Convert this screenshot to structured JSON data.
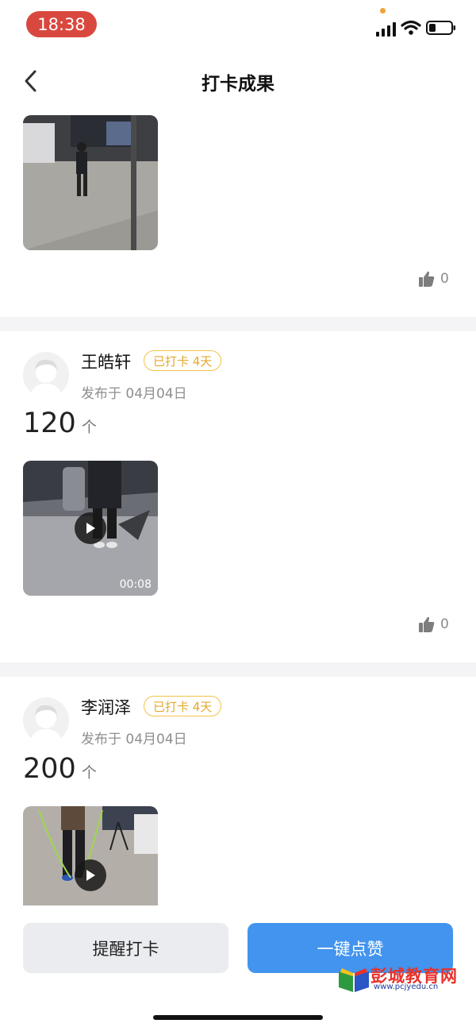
{
  "status_bar": {
    "time": "18:38"
  },
  "nav": {
    "title": "打卡成果"
  },
  "posts": [
    {
      "likes": "0"
    },
    {
      "user_name": "王皓轩",
      "badge": "已打卡 4天",
      "published": "发布于 04月04日",
      "count": "120",
      "unit": "个",
      "video_duration": "00:08",
      "likes": "0"
    },
    {
      "user_name": "李润泽",
      "badge": "已打卡 4天",
      "published": "发布于 04月04日",
      "count": "200",
      "unit": "个"
    }
  ],
  "bottom": {
    "remind_label": "提醒打卡",
    "like_all_label": "一键点赞"
  },
  "watermark": {
    "title": "彭城教育网",
    "url": "www.pcjyedu.cn"
  },
  "colors": {
    "accent": "#4294ee",
    "badge": "#f1c348",
    "time_pill": "#d9483e",
    "watermark": "#e8312a"
  }
}
